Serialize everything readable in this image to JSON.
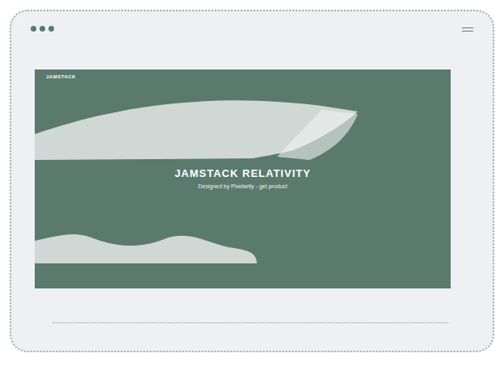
{
  "page": {
    "logo": "JAMSTACK",
    "title": "JAMSTACK RELATIVITY",
    "subtitle": "Designed by Pixelarity - get product"
  }
}
